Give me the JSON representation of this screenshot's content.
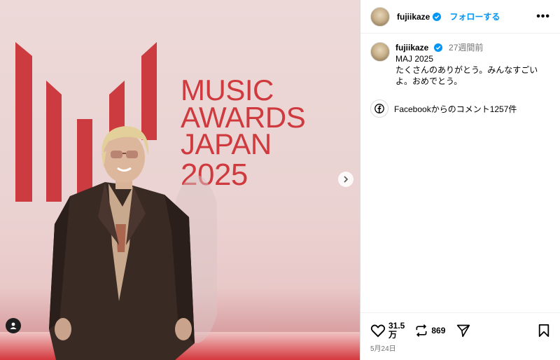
{
  "post": {
    "username": "fujiikaze",
    "follow_label": "フォローする",
    "more_label": "•••",
    "time_ago": "27週間前",
    "caption_line1": "MAJ 2025",
    "caption_line2": "たくさんのありがとう。みんなすごい\nよ。おめでとう。",
    "facebook_comments": "Facebookからのコメント1257件",
    "likes_line1": "31.5",
    "likes_line2": "万",
    "reposts": "869",
    "date": "5月24日"
  },
  "media": {
    "backdrop_line1": "MUSIC",
    "backdrop_line2": "AWARDS",
    "backdrop_line3": "JAPAN",
    "backdrop_year": "2025"
  },
  "colors": {
    "accent": "#0095f6",
    "backdrop_red": "#cf3a3e",
    "verified": "#0095f6"
  },
  "icons": [
    "verified-icon",
    "more-icon",
    "facebook-icon",
    "heart-icon",
    "repost-icon",
    "share-icon",
    "bookmark-icon",
    "chevron-right-icon",
    "user-tag-icon"
  ]
}
